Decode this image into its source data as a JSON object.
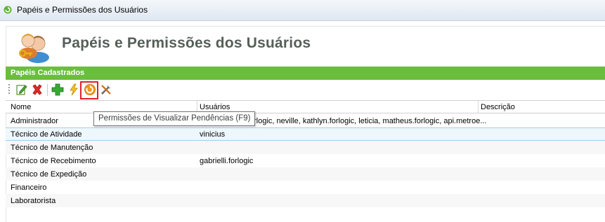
{
  "window": {
    "title": "Papéis e Permissões dos Usuários"
  },
  "header": {
    "title": "Papéis e Permissões dos Usuários",
    "icon": "users-key-icon"
  },
  "panel": {
    "title": "Papéis Cadastrados"
  },
  "toolbar": {
    "buttons": [
      {
        "name": "edit-icon"
      },
      {
        "name": "delete-icon"
      },
      {
        "name": "add-icon"
      },
      {
        "name": "lightning-icon"
      },
      {
        "name": "pending-permissions-icon"
      },
      {
        "name": "tools-icon"
      }
    ]
  },
  "tooltip": {
    "text": "Permissões de Visualizar Pendências (F9)"
  },
  "grid": {
    "columns": [
      "Nome",
      "Usuários",
      "Descrição"
    ],
    "rows": [
      {
        "nome": "Administrador",
        "usuarios": "orlogic, neville, kathlyn.forlogic, leticia, matheus.forlogic, api.metroe..."
      },
      {
        "nome": "Técnico de Atividade",
        "usuarios": "vinicius"
      },
      {
        "nome": "Técnico de Manutenção",
        "usuarios": ""
      },
      {
        "nome": "Técnico de Recebimento",
        "usuarios": "gabrielli.forlogic"
      },
      {
        "nome": "Técnico de Expedição",
        "usuarios": ""
      },
      {
        "nome": "Financeiro",
        "usuarios": ""
      },
      {
        "nome": "Laboratorista",
        "usuarios": ""
      }
    ],
    "selected_row": 1
  },
  "colors": {
    "panel_green": "#6abe3e",
    "highlight_red": "#e0202a",
    "selection": "#eef7fb"
  }
}
